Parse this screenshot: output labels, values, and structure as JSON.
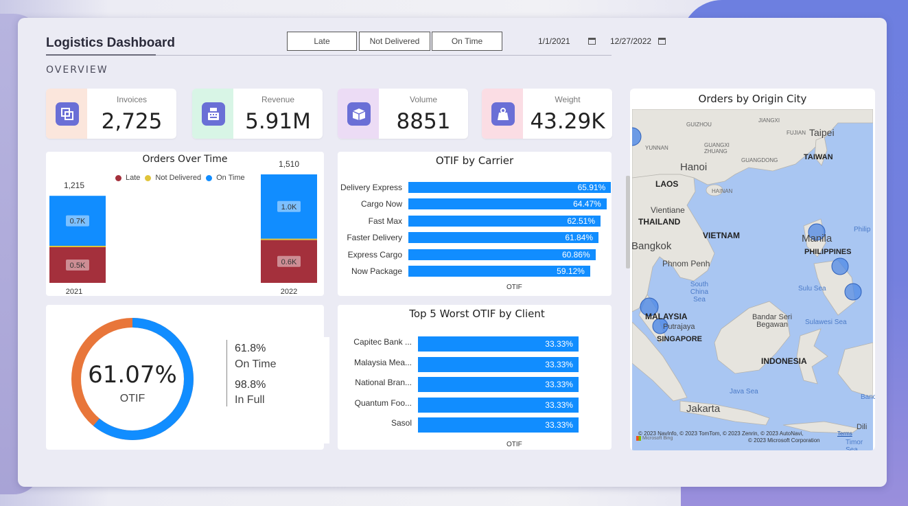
{
  "title": "Logistics Dashboard",
  "section": "OVERVIEW",
  "slicer": {
    "buttons": [
      "Late",
      "Not Delivered",
      "On Time"
    ]
  },
  "date_range": {
    "start": "1/1/2021",
    "end": "12/27/2022"
  },
  "kpis": [
    {
      "label": "Invoices",
      "value": "2,725",
      "icon": "invoice-icon",
      "bg": "#fbe6dc"
    },
    {
      "label": "Revenue",
      "value": "5.91M",
      "icon": "cash-register-icon",
      "bg": "#d8f5e6"
    },
    {
      "label": "Volume",
      "value": "8851",
      "icon": "box-icon",
      "bg": "#ecdcf5"
    },
    {
      "label": "Weight",
      "value": "43.29K",
      "icon": "weight-icon",
      "bg": "#fbdde4"
    }
  ],
  "orders_over_time": {
    "title": "Orders Over Time",
    "legend": [
      "Late",
      "Not Delivered",
      "On Time"
    ],
    "colors": {
      "late": "#a4303c",
      "not_delivered": "#e0c43a",
      "on_time": "#118dff"
    },
    "chart_data": {
      "type": "bar",
      "categories": [
        "2021",
        "2022"
      ],
      "series": [
        {
          "name": "Late",
          "values": [
            500,
            600
          ],
          "labels": [
            "0.5K",
            "0.6K"
          ]
        },
        {
          "name": "Not Delivered",
          "values": [
            15,
            10
          ],
          "labels": [
            "",
            ""
          ]
        },
        {
          "name": "On Time",
          "values": [
            700,
            900
          ],
          "labels": [
            "0.7K",
            "1.0K"
          ]
        }
      ],
      "totals": [
        "1,215",
        "1,510"
      ]
    }
  },
  "otif_by_carrier": {
    "title": "OTIF by Carrier",
    "xlabel": "OTIF",
    "chart_data": {
      "type": "bar",
      "categories": [
        "Delivery Express",
        "Cargo Now",
        "Fast Max",
        "Faster Delivery",
        "Express Cargo",
        "Now Package"
      ],
      "values": [
        65.91,
        64.47,
        62.51,
        61.84,
        60.86,
        59.12
      ],
      "labels": [
        "65.91%",
        "64.47%",
        "62.51%",
        "61.84%",
        "60.86%",
        "59.12%"
      ]
    }
  },
  "otif_donut": {
    "value": "61.07%",
    "label": "OTIF",
    "fraction": 0.6107,
    "color_main": "#118dff",
    "color_rest": "#e8763a",
    "side": [
      {
        "value": "61.8%",
        "label": "On Time"
      },
      {
        "value": "98.8%",
        "label": "In Full"
      }
    ]
  },
  "worst_clients": {
    "title": "Top 5 Worst OTIF by Client",
    "xlabel": "OTIF",
    "chart_data": {
      "type": "bar",
      "categories": [
        "Capitec Bank ...",
        "Malaysia Mea...",
        "National Bran...",
        "Quantum Foo...",
        "Sasol"
      ],
      "values": [
        33.33,
        33.33,
        33.33,
        33.33,
        33.33
      ],
      "labels": [
        "33.33%",
        "33.33%",
        "33.33%",
        "33.33%",
        "33.33%"
      ]
    }
  },
  "map": {
    "title": "Orders by Origin City",
    "labels": {
      "guizhou": "GUIZHOU",
      "jiangxi": "JIANGXI",
      "fujian": "FUJIAN",
      "taipei": "Taipei",
      "taiwan": "TAIWAN",
      "yunnan": "YUNNAN",
      "guangxi": "GUANGXI ZHUANG",
      "guangdong": "GUANGDONG",
      "hanoi": "Hanoi",
      "laos": "LAOS",
      "hainan": "HAINAN",
      "vientiane": "Vientiane",
      "thailand": "THAILAND",
      "vietnam": "VIETNAM",
      "bangkok": "Bangkok",
      "manila": "Manila",
      "philippines": "PHILIPPINES",
      "philip": "Philip",
      "phnompenh": "Phnom Penh",
      "southchinasea": "South China Sea",
      "sulusea": "Sulu Sea",
      "malaysia": "MALAYSIA",
      "putrajaya": "Putrajaya",
      "bandar": "Bandar Seri Begawan",
      "sulawesisea": "Sulawesi Sea",
      "singapore": "SINGAPORE",
      "indonesia": "INDONESIA",
      "javasea": "Java Sea",
      "banda": "Banda",
      "jakarta": "Jakarta",
      "dili": "Dili",
      "timor": "Timor Sea"
    },
    "copyright": "© 2023 NavInfo, © 2023 TomTom, © 2023 Zenrin, © 2023 AutoNavi,",
    "terms": "Terms",
    "copyright2": "© 2023 Microsoft Corporation",
    "bing": "Microsoft Bing"
  }
}
